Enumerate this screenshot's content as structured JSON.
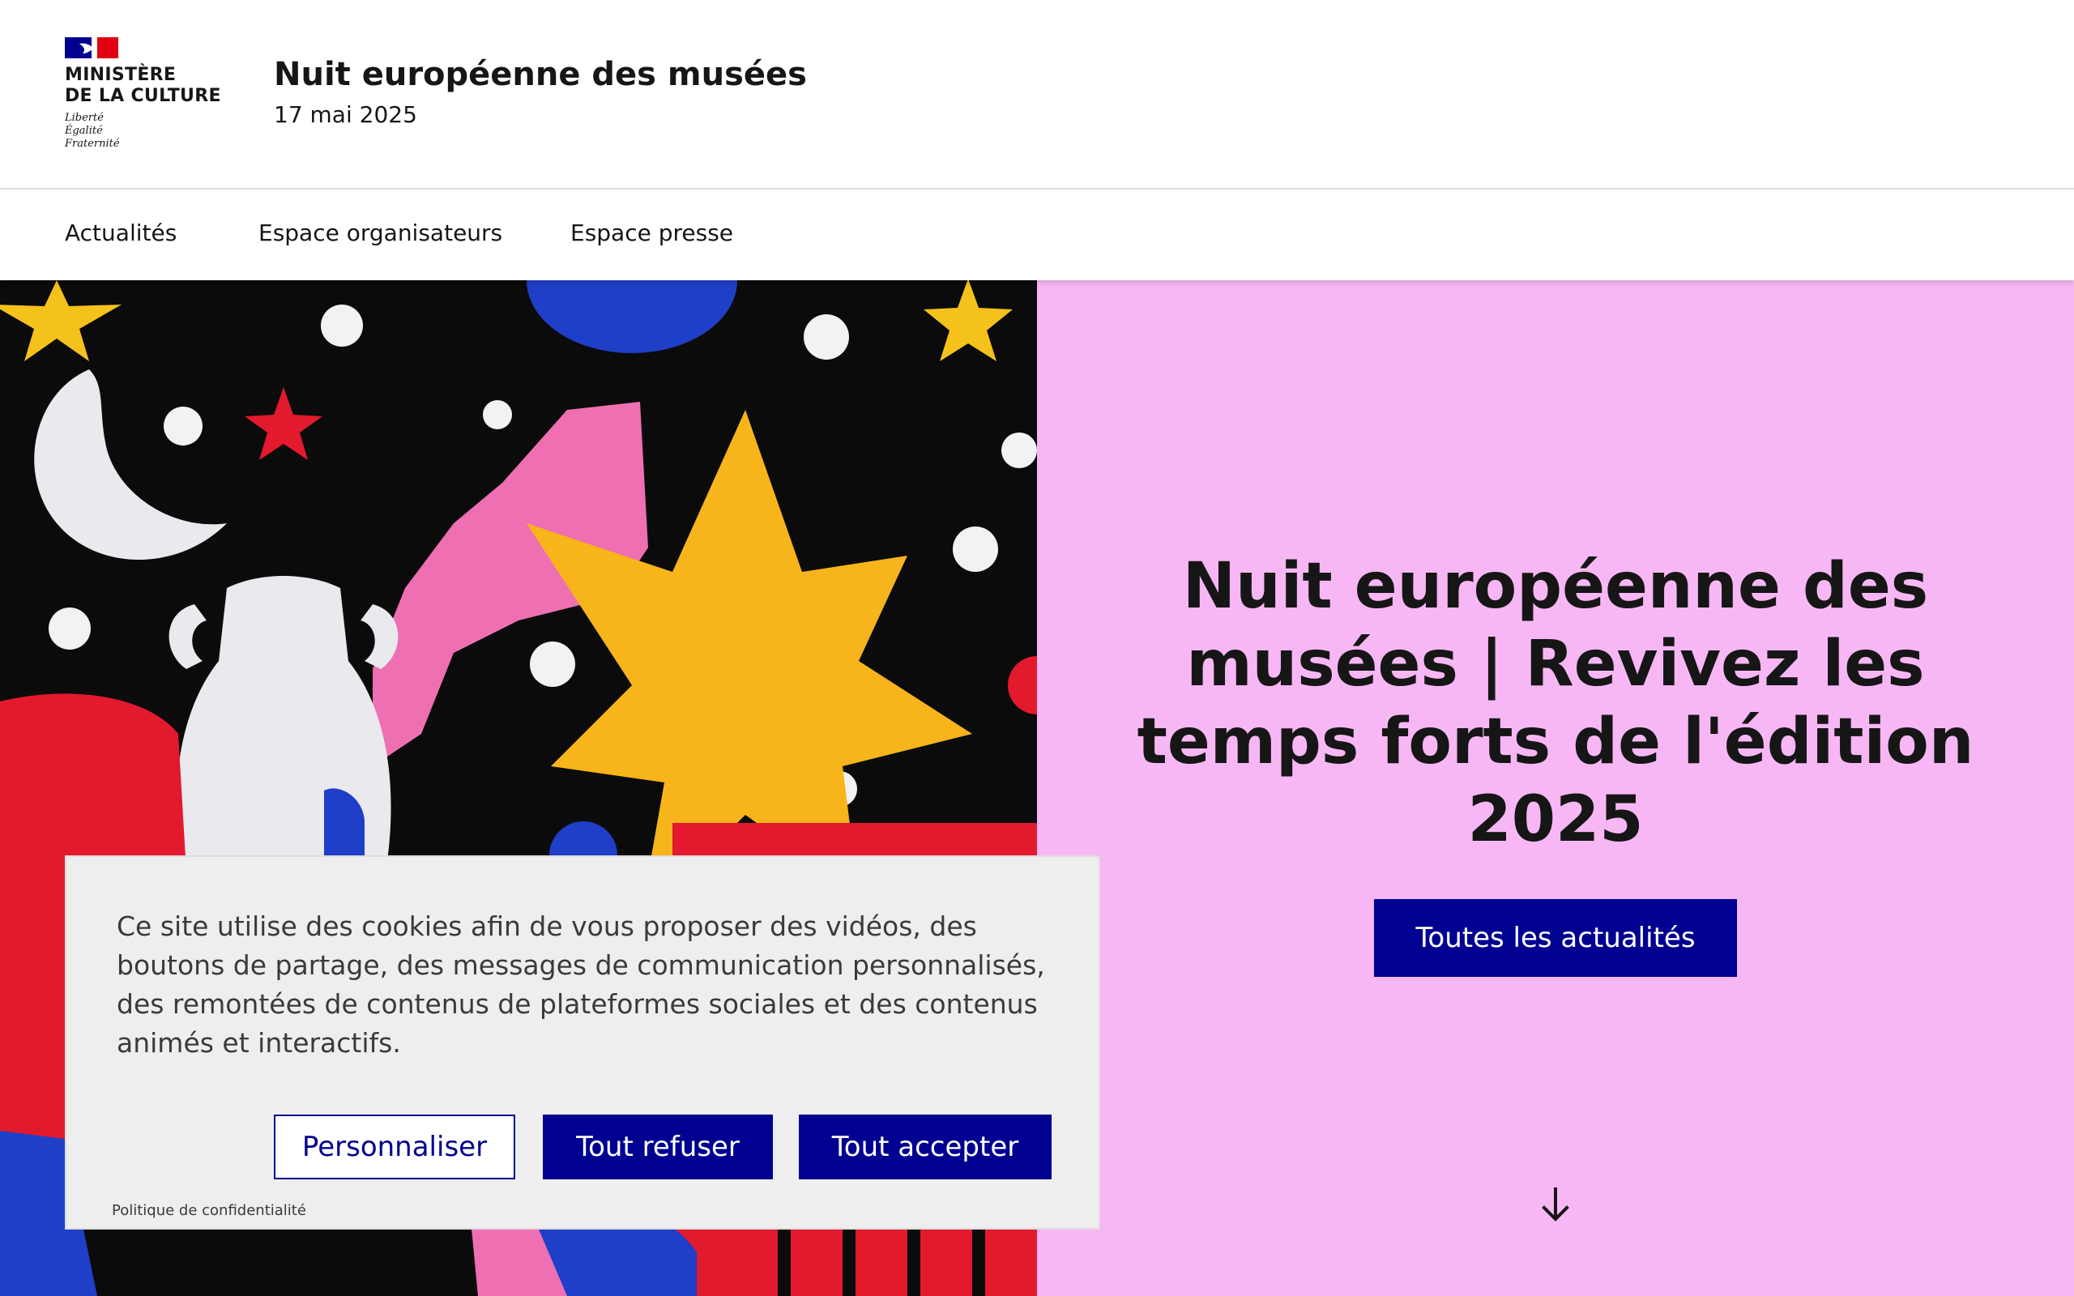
{
  "header": {
    "logo": {
      "ministry_line1": "MINISTÈRE",
      "ministry_line2": "DE LA CULTURE",
      "motto_1": "Liberté",
      "motto_2": "Égalité",
      "motto_3": "Fraternité"
    },
    "site_title": "Nuit européenne des musées",
    "site_subtitle": "17 mai 2025"
  },
  "nav": {
    "items": [
      {
        "label": "Actualités"
      },
      {
        "label": "Espace organisateurs"
      },
      {
        "label": "Espace presse"
      }
    ]
  },
  "hero": {
    "title_bold": "Nuit européenne des musées |",
    "title_regular": " Revivez les temps forts de l'édition 2025",
    "button_label": "Toutes les actualités",
    "scroll_icon": "arrow-down-icon",
    "panel_color": "#f7b7f4"
  },
  "cookie_banner": {
    "text": "Ce site utilise des cookies afin de vous proposer des vidéos, des boutons de partage, des messages de communication personnalisés, des remontées de contenus de plateformes sociales et des contenus animés et interactifs.",
    "customize_label": "Personnaliser",
    "refuse_label": "Tout refuser",
    "accept_label": "Tout accepter",
    "privacy_label": "Politique de confidentialité"
  },
  "colors": {
    "primary_blue": "#000091",
    "flag_blue": "#000091",
    "flag_red": "#e1000f",
    "text": "#161616"
  }
}
